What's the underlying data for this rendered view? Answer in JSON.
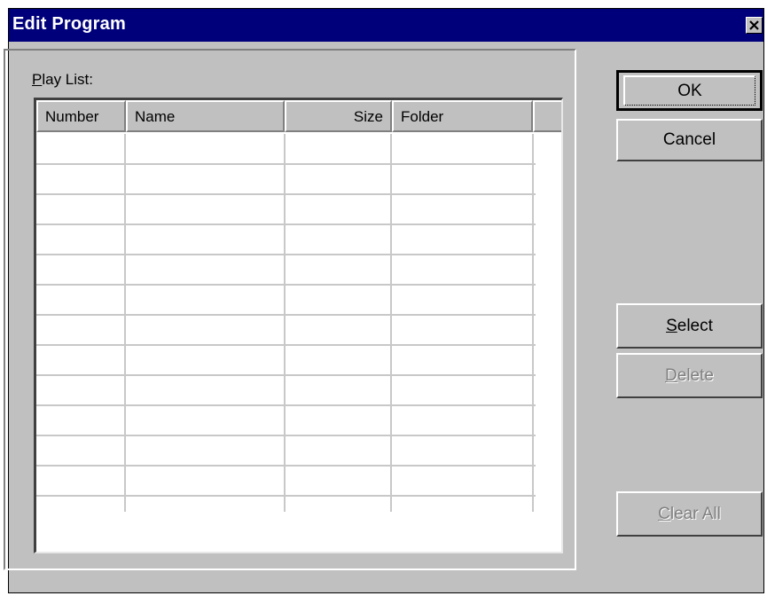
{
  "window": {
    "title": "Edit Program"
  },
  "playlist": {
    "label": "Play List:",
    "columns": [
      "Number",
      "Name",
      "Size",
      "Folder"
    ],
    "rows": []
  },
  "buttons": {
    "ok": "OK",
    "cancel": "Cancel",
    "select": "Select",
    "delete": "Delete",
    "clear_all": "Clear All"
  },
  "icons": {
    "close": "close-icon"
  }
}
